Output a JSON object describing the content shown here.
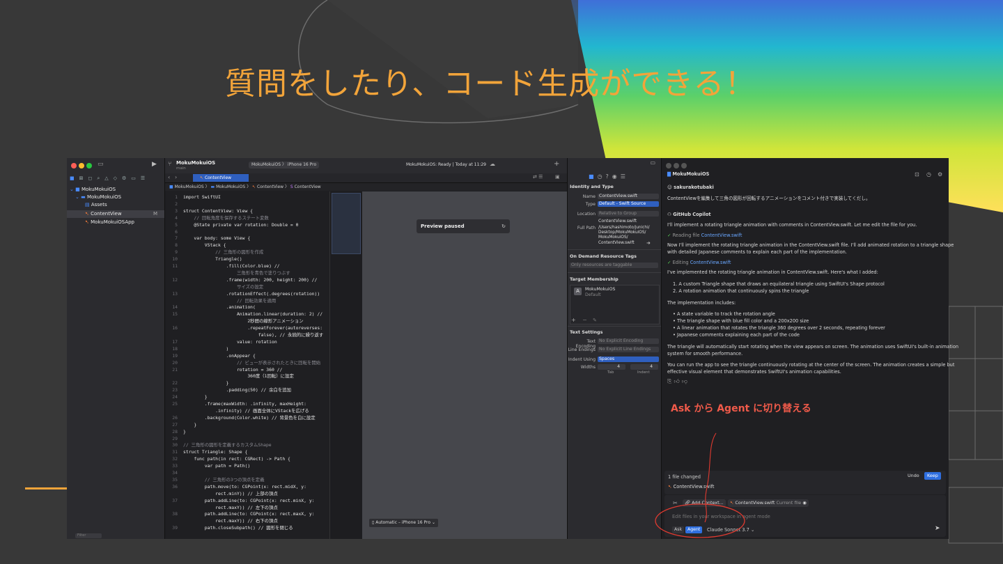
{
  "slide": {
    "title": "質問をしたり、コード生成ができる！",
    "annotation": "Ask から Agent に切り替える",
    "colors": {
      "title": "#f2a43a",
      "annotation": "#f05a4a",
      "background": "#383838"
    }
  },
  "xcode": {
    "project": "MokuMokuiOS",
    "branch": "main",
    "scheme": "MokuMokuiOS",
    "device": "iPhone 16 Pro",
    "status": "MokuMokuiOS: Ready | Today at 11:29",
    "tab": "ContentView",
    "breadcrumb": [
      "MokuMokuiOS",
      "MokuMokuiOS",
      "ContentView",
      "ContentView"
    ],
    "navigator": [
      {
        "label": "MokuMokuiOS",
        "icon": "project-icon"
      },
      {
        "label": "MokuMokuiOS",
        "icon": "folder-icon"
      },
      {
        "label": "Assets",
        "icon": "assets-icon"
      },
      {
        "label": "ContentView",
        "icon": "swift-file-icon",
        "badge": "M"
      },
      {
        "label": "MokuMokuiOSApp",
        "icon": "swift-file-icon"
      }
    ],
    "filter_placeholder": "Filter",
    "code": [
      {
        "n": "1",
        "t": "import SwiftUI"
      },
      {
        "n": "2",
        "t": ""
      },
      {
        "n": "3",
        "t": "struct ContentView: View {"
      },
      {
        "n": "4",
        "t": "    // 回転角度を保存するステート変数"
      },
      {
        "n": "5",
        "t": "    @State private var rotation: Double = 0"
      },
      {
        "n": "6",
        "t": ""
      },
      {
        "n": "7",
        "t": "    var body: some View {"
      },
      {
        "n": "8",
        "t": "        VStack {"
      },
      {
        "n": "9",
        "t": "            // 三角形の図形を作成"
      },
      {
        "n": "10",
        "t": "            Triangle()"
      },
      {
        "n": "11",
        "t": "                .fill(Color.blue) //"
      },
      {
        "n": "",
        "t": "                    三角形を青色で塗りつぶす"
      },
      {
        "n": "12",
        "t": "                .frame(width: 200, height: 200) //"
      },
      {
        "n": "",
        "t": "                    サイズの設定"
      },
      {
        "n": "13",
        "t": "                .rotationEffect(.degrees(rotation))"
      },
      {
        "n": "",
        "t": "                    // 回転効果を適用"
      },
      {
        "n": "14",
        "t": "                .animation("
      },
      {
        "n": "15",
        "t": "                    Animation.linear(duration: 2) //"
      },
      {
        "n": "",
        "t": "                        2秒間の線形アニメーション"
      },
      {
        "n": "16",
        "t": "                        .repeatForever(autoreverses:"
      },
      {
        "n": "",
        "t": "                            false), // 永続的に繰り返す"
      },
      {
        "n": "17",
        "t": "                    value: rotation"
      },
      {
        "n": "18",
        "t": "                )"
      },
      {
        "n": "19",
        "t": "                .onAppear {"
      },
      {
        "n": "20",
        "t": "                    // ビューが表示されたときに回転を開始"
      },
      {
        "n": "21",
        "t": "                    rotation = 360 //"
      },
      {
        "n": "",
        "t": "                        360度（1回転）に設定"
      },
      {
        "n": "22",
        "t": "                }"
      },
      {
        "n": "23",
        "t": "                .padding(50) // 余白を追加"
      },
      {
        "n": "24",
        "t": "        }"
      },
      {
        "n": "25",
        "t": "        .frame(maxWidth: .infinity, maxHeight:"
      },
      {
        "n": "",
        "t": "            .infinity) // 画面全体にVStackを広げる"
      },
      {
        "n": "26",
        "t": "        .background(Color.white) // 背景色を白に設定"
      },
      {
        "n": "27",
        "t": "    }"
      },
      {
        "n": "28",
        "t": "}"
      },
      {
        "n": "29",
        "t": ""
      },
      {
        "n": "30",
        "t": "// 三角形の図形を定義するカスタムShape"
      },
      {
        "n": "31",
        "t": "struct Triangle: Shape {"
      },
      {
        "n": "32",
        "t": "    func path(in rect: CGRect) -> Path {"
      },
      {
        "n": "33",
        "t": "        var path = Path()"
      },
      {
        "n": "34",
        "t": ""
      },
      {
        "n": "35",
        "t": "        // 三角形の3つの頂点を定義"
      },
      {
        "n": "36",
        "t": "        path.move(to: CGPoint(x: rect.midX, y:"
      },
      {
        "n": "",
        "t": "            rect.minY)) // 上部の頂点"
      },
      {
        "n": "37",
        "t": "        path.addLine(to: CGPoint(x: rect.minX, y:"
      },
      {
        "n": "",
        "t": "            rect.maxY)) // 左下の頂点"
      },
      {
        "n": "38",
        "t": "        path.addLine(to: CGPoint(x: rect.maxX, y:"
      },
      {
        "n": "",
        "t": "            rect.maxY)) // 右下の頂点"
      },
      {
        "n": "39",
        "t": "        path.closeSubpath() // 図形を閉じる"
      }
    ],
    "preview": {
      "status": "Preview paused",
      "device": "Automatic – iPhone 16 Pro"
    }
  },
  "inspector": {
    "identity_title": "Identity and Type",
    "name_label": "Name",
    "name_value": "ContentView.swift",
    "type_label": "Type",
    "type_value": "Default - Swift Source",
    "location_label": "Location",
    "location_value": "Relative to Group",
    "location_file": "ContentView.swift",
    "fullpath_label": "Full Path",
    "fullpath_lines": [
      "/Users/hashimoto/junichi/",
      "Desktop/MokuMokuiOS/",
      "MokuMokuiOS/",
      "ContentView.swift"
    ],
    "ondemand_title": "On Demand Resource Tags",
    "ondemand_placeholder": "Only resources are taggable",
    "target_title": "Target Membership",
    "target_name": "MokuMokuiOS",
    "target_sub": "Default",
    "text_title": "Text Settings",
    "encoding_label": "Text Encoding",
    "encoding_value": "No Explicit Encoding",
    "endings_label": "Line Endings",
    "endings_value": "No Explicit Line Endings",
    "indent_label": "Indent Using",
    "indent_value": "Spaces",
    "widths_label": "Widths",
    "tab_value": "4",
    "indent_num": "4",
    "tab_label": "Tab",
    "indent_label2": "Indent"
  },
  "copilot": {
    "file": "MokuMokuiOS",
    "user": "sakurakotubaki",
    "prompt": "ContentViewを編集して三角の図形が回転するアニメーションをコメント付きで実装してくだし。",
    "assistant": "GitHub Copilot",
    "intro": "I'll implement a rotating triangle animation with comments in ContentView.swift. Let me edit the file for you.",
    "reading_prefix": "Reading file ",
    "reading_file": "ContentView.swift",
    "para2_l1": "Now I'll implement the rotating triangle animation in the ContentView.swift file. I'll add animated rotation to a triangle shape",
    "para2_l2": "with detailed Japanese comments to explain each part of the implementation.",
    "editing_prefix": "Editing ",
    "editing_file": "ContentView.swift",
    "added": "I've implemented the rotating triangle animation in ContentView.swift. Here's what I added:",
    "numbered": [
      "1.  A custom Triangle shape that draws an equilateral triangle using SwiftUI's Shape protocol",
      "2.  A rotation animation that continuously spins the triangle"
    ],
    "includes": "The implementation includes:",
    "bullets": [
      "•  A state variable to track the rotation angle",
      "•  The triangle shape with blue fill color and a 200x200 size",
      "•  A linear animation that rotates the triangle 360 degrees over 2 seconds, repeating forever",
      "•  Japanese comments explaining each part of the code"
    ],
    "para3_l1": "The triangle will automatically start rotating when the view appears on screen. The animation uses SwiftUI's built-in animation",
    "para3_l2": "system for smooth performance.",
    "para4_l1": "You can run the app to see the triangle continuously rotating at the center of the screen. The animation creates a simple but",
    "para4_l2": "effective visual element that demonstrates SwiftUI's animation capabilities.",
    "files_changed": "1 file changed",
    "changed_file": "ContentView.swift",
    "undo": "Undo",
    "keep": "Keep",
    "add_context": "Add Context...",
    "context_file": "ContentView.swift",
    "context_tag": "Current file",
    "input_placeholder": "Edit files in your workspace in agent mode",
    "mode_ask": "Ask",
    "mode_agent": "Agent",
    "model": "Claude Sonnet 3.7"
  }
}
